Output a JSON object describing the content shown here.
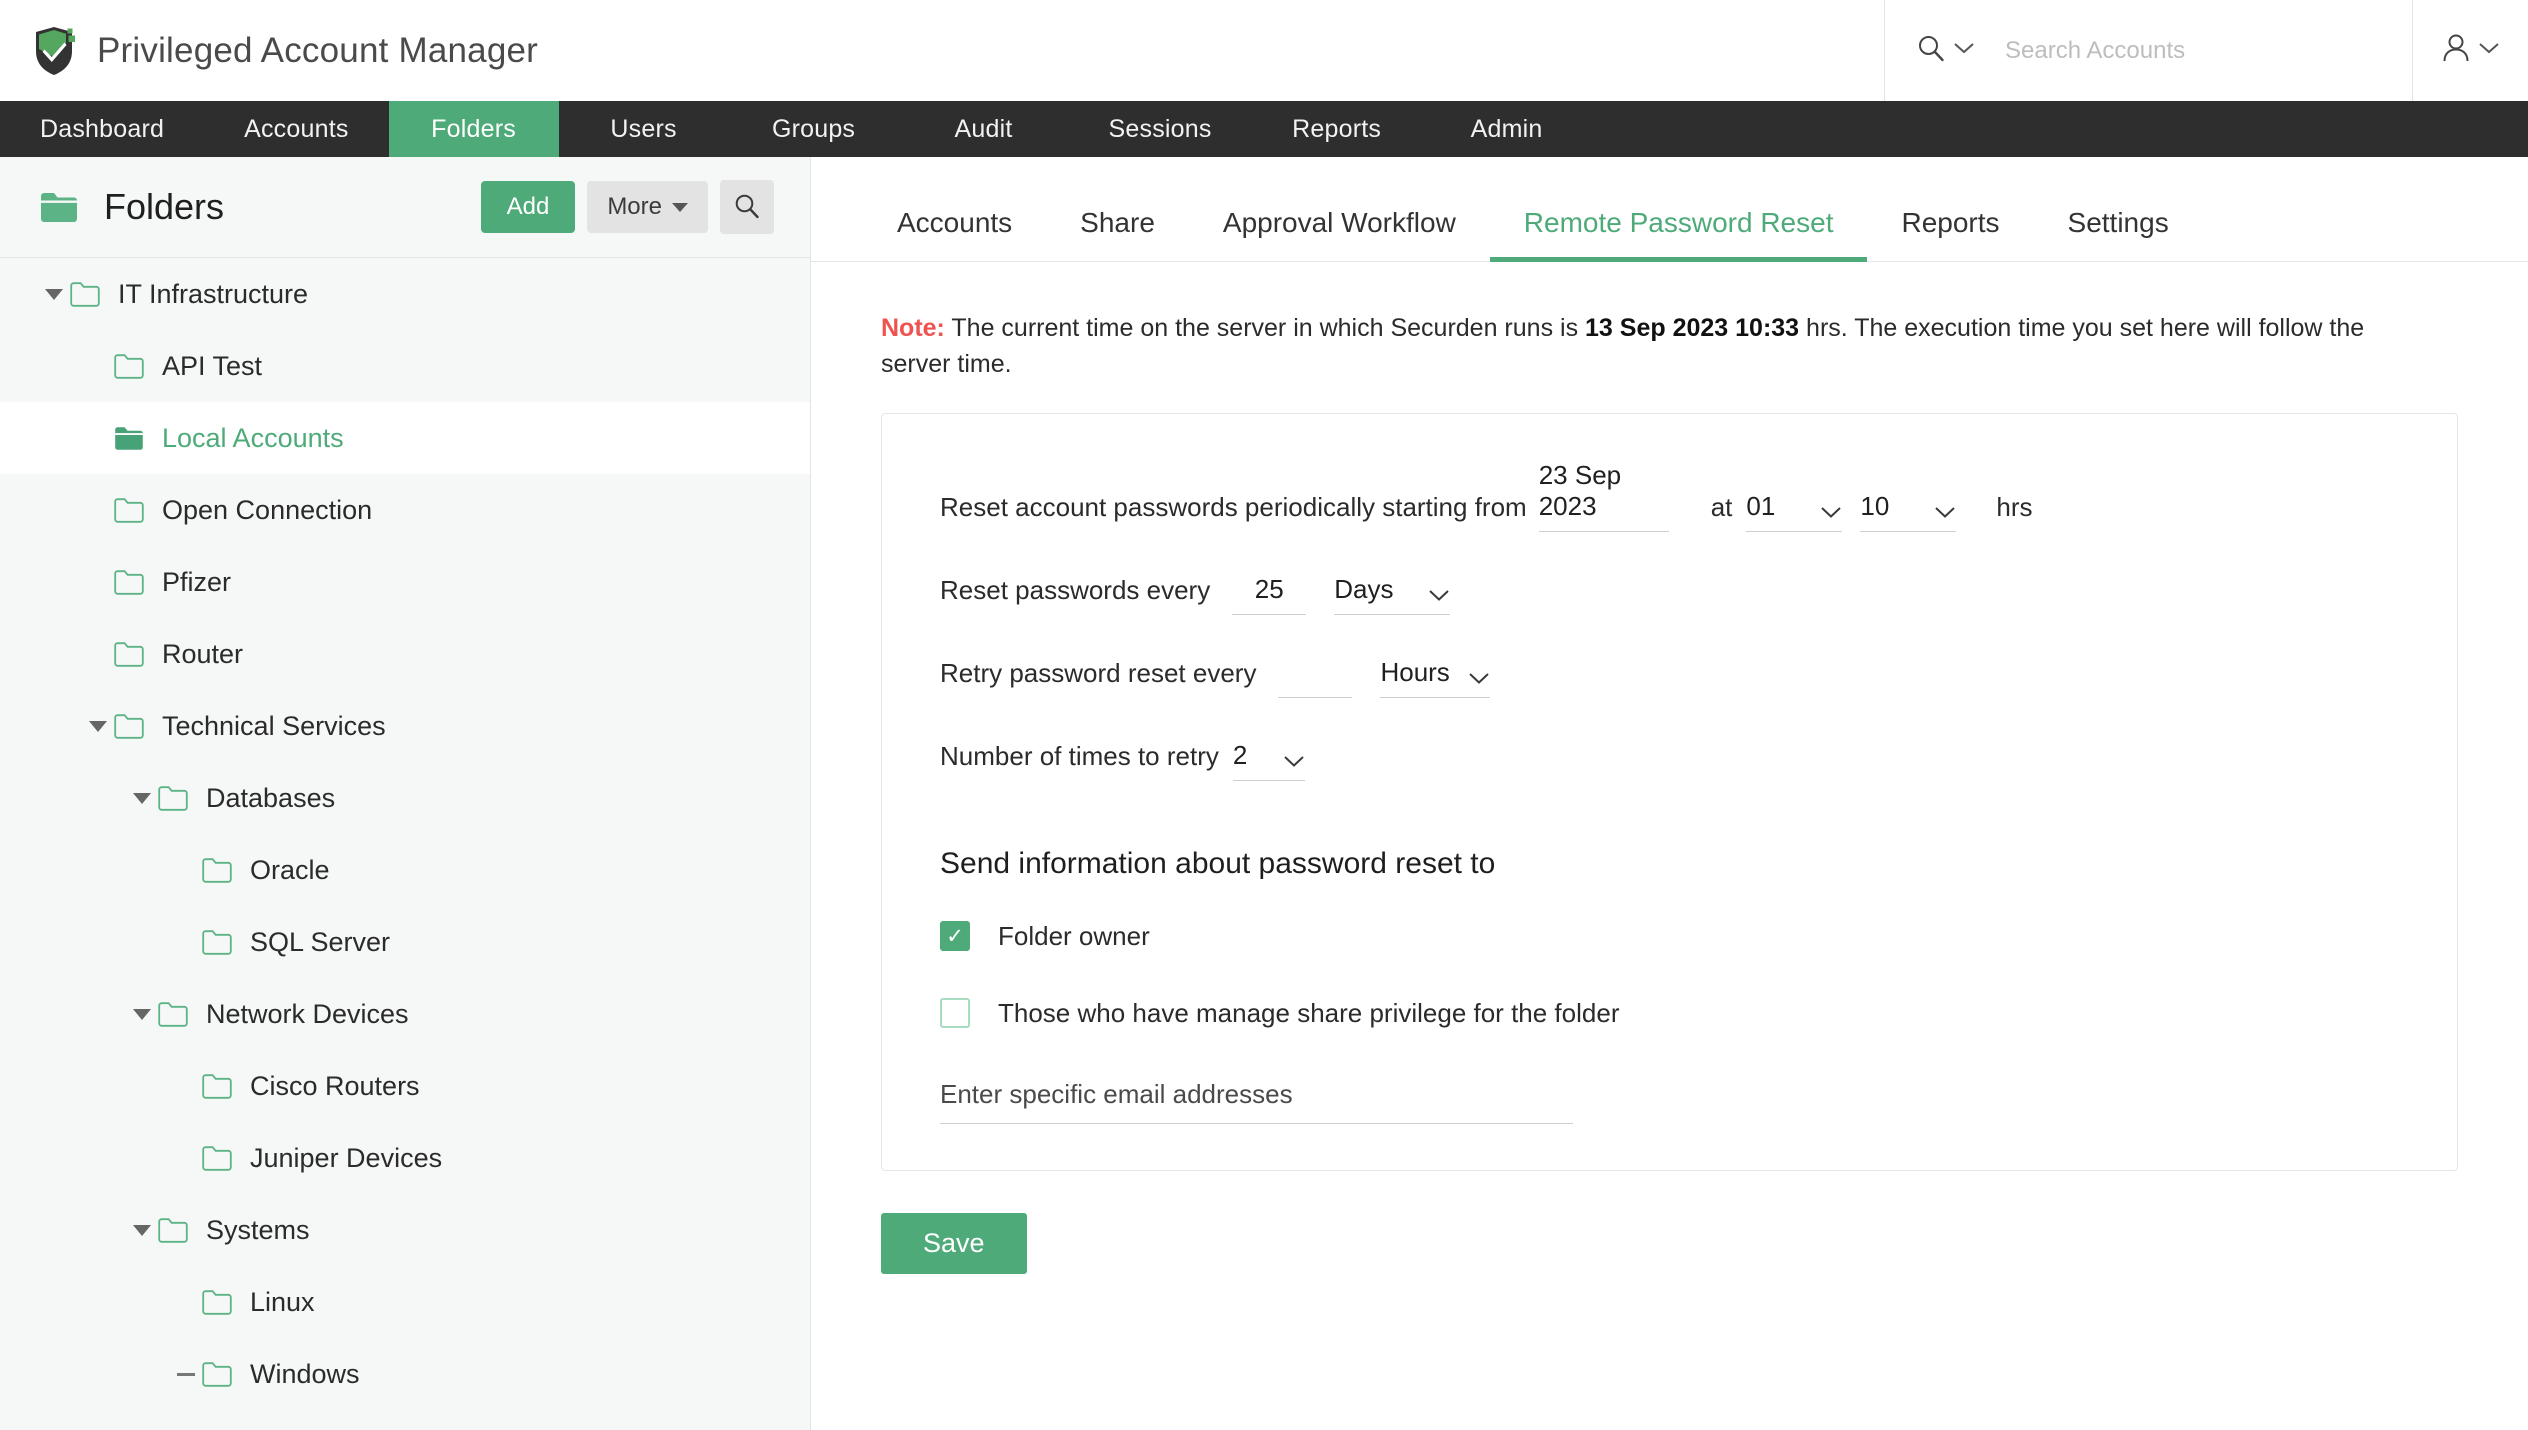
{
  "colors": {
    "accent": "#4eab79",
    "navbar_bg": "#2e2e2e",
    "sidebar_bg": "#f6f7f7",
    "note_red": "#ef5350"
  },
  "header": {
    "app_title": "Privileged Account Manager",
    "search_placeholder": "Search Accounts",
    "search_value": "",
    "search_icon": "search-icon",
    "search_caret_icon": "chevron-down-icon",
    "user_icon": "user-icon",
    "user_caret_icon": "chevron-down-icon"
  },
  "nav": {
    "items": [
      {
        "label": "Dashboard",
        "active": false
      },
      {
        "label": "Accounts",
        "active": false
      },
      {
        "label": "Folders",
        "active": true
      },
      {
        "label": "Users",
        "active": false
      },
      {
        "label": "Groups",
        "active": false
      },
      {
        "label": "Audit",
        "active": false
      },
      {
        "label": "Sessions",
        "active": false
      },
      {
        "label": "Reports",
        "active": false
      },
      {
        "label": "Admin",
        "active": false
      }
    ]
  },
  "sidebar": {
    "title": "Folders",
    "folder_icon": "folder-filled-icon",
    "add_label": "Add",
    "more_label": "More",
    "search_icon": "search-icon",
    "tree": [
      {
        "label": "IT Infrastructure",
        "depth": 0,
        "twisty": "expanded",
        "selected": false
      },
      {
        "label": "API Test",
        "depth": 1,
        "twisty": "none",
        "selected": false
      },
      {
        "label": "Local Accounts",
        "depth": 1,
        "twisty": "none",
        "selected": true
      },
      {
        "label": "Open Connection",
        "depth": 1,
        "twisty": "none",
        "selected": false
      },
      {
        "label": "Pfizer",
        "depth": 1,
        "twisty": "none",
        "selected": false
      },
      {
        "label": "Router",
        "depth": 1,
        "twisty": "none",
        "selected": false
      },
      {
        "label": "Technical Services",
        "depth": 1,
        "twisty": "expanded",
        "selected": false
      },
      {
        "label": "Databases",
        "depth": 2,
        "twisty": "expanded",
        "selected": false
      },
      {
        "label": "Oracle",
        "depth": 3,
        "twisty": "none",
        "selected": false
      },
      {
        "label": "SQL Server",
        "depth": 3,
        "twisty": "none",
        "selected": false
      },
      {
        "label": "Network Devices",
        "depth": 2,
        "twisty": "expanded",
        "selected": false
      },
      {
        "label": "Cisco Routers",
        "depth": 3,
        "twisty": "none",
        "selected": false
      },
      {
        "label": "Juniper Devices",
        "depth": 3,
        "twisty": "none",
        "selected": false
      },
      {
        "label": "Systems",
        "depth": 2,
        "twisty": "expanded",
        "selected": false
      },
      {
        "label": "Linux",
        "depth": 3,
        "twisty": "none",
        "selected": false
      },
      {
        "label": "Windows",
        "depth": 3,
        "twisty": "dash",
        "selected": false
      }
    ]
  },
  "main": {
    "tabs": [
      {
        "label": "Accounts",
        "active": false
      },
      {
        "label": "Share",
        "active": false
      },
      {
        "label": "Approval Workflow",
        "active": false
      },
      {
        "label": "Remote Password Reset",
        "active": true
      },
      {
        "label": "Reports",
        "active": false
      },
      {
        "label": "Settings",
        "active": false
      }
    ],
    "note": {
      "prefix": "Note:",
      "text_before": "The current time on the server in which Securden runs is",
      "timestamp": "13 Sep 2023 10:33",
      "text_after": "hrs. The execution time you set here will follow the server time."
    },
    "form": {
      "start_label": "Reset account passwords periodically starting from",
      "start_date": "23 Sep 2023",
      "at_label": "at",
      "hour_value": "01",
      "minute_value": "10",
      "hrs_label": "hrs",
      "every_label": "Reset passwords every",
      "every_value": "25",
      "every_unit": "Days",
      "retry_label": "Retry password reset every",
      "retry_value": "",
      "retry_unit": "Hours",
      "times_label": "Number of times to retry",
      "times_value": "2",
      "chevron_icon": "chevron-down-icon"
    },
    "notify": {
      "heading": "Send information about password reset to",
      "folder_owner_label": "Folder owner",
      "folder_owner_checked": true,
      "manage_share_label": "Those who have manage share privilege for the folder",
      "manage_share_checked": false,
      "email_placeholder": "Enter specific email addresses",
      "email_value": ""
    },
    "save_label": "Save"
  }
}
